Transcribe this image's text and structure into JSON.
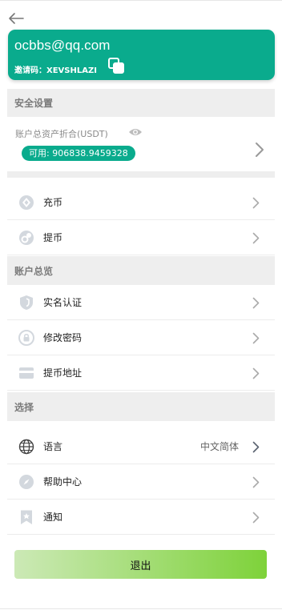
{
  "header": {
    "email": "ocbbs@qq.com",
    "invite_label": "邀请码：",
    "invite_code": "XEVSHLAZI"
  },
  "sections": {
    "security": "安全设置",
    "overview": "账户总览",
    "choose": "选择"
  },
  "asset": {
    "label": "账户总资产折合(USDT)",
    "available_label": "可用:",
    "available_value": "906838.9459328"
  },
  "menu": {
    "deposit": "充币",
    "withdraw": "提币",
    "verify": "实名认证",
    "password": "修改密码",
    "address": "提币地址",
    "language": "语言",
    "language_value": "中文简体",
    "help": "帮助中心",
    "notify": "通知"
  },
  "logout": "退出",
  "colors": {
    "brand": "#0aab8d",
    "section_bg": "#eeeeee",
    "icon": "#c8ced6"
  }
}
